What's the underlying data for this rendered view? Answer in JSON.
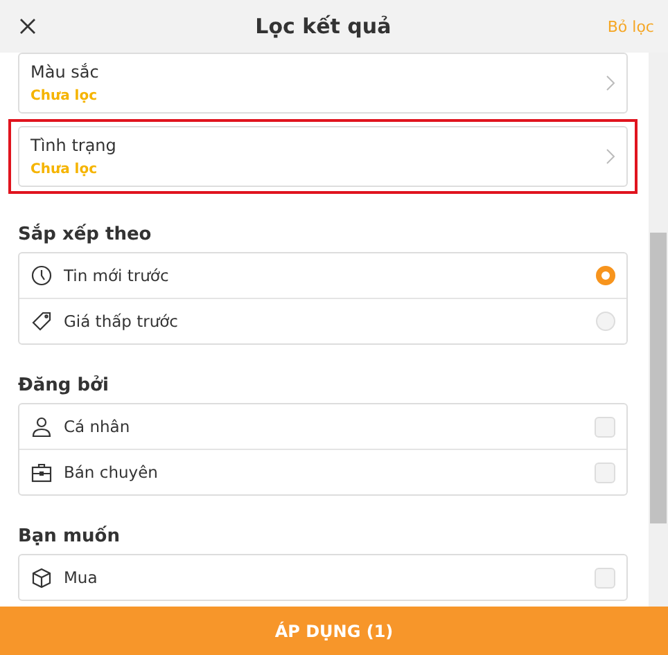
{
  "header": {
    "title": "Lọc kết quả",
    "reset": "Bỏ lọc"
  },
  "filters": [
    {
      "label": "Màu sắc",
      "value": "Chưa lọc",
      "highlighted": false
    },
    {
      "label": "Tình trạng",
      "value": "Chưa lọc",
      "highlighted": true
    }
  ],
  "sections": [
    {
      "title": "Sắp xếp theo",
      "kind": "radio",
      "options": [
        {
          "label": "Tin mới trước",
          "selected": true
        },
        {
          "label": "Giá thấp trước",
          "selected": false
        }
      ]
    },
    {
      "title": "Đăng bởi",
      "kind": "checkbox",
      "options": [
        {
          "label": "Cá nhân",
          "selected": false
        },
        {
          "label": "Bán chuyên",
          "selected": false
        }
      ]
    },
    {
      "title": "Bạn muốn",
      "kind": "checkbox",
      "options": [
        {
          "label": "Mua",
          "selected": false
        }
      ]
    }
  ],
  "apply": "ÁP DỤNG (1)"
}
